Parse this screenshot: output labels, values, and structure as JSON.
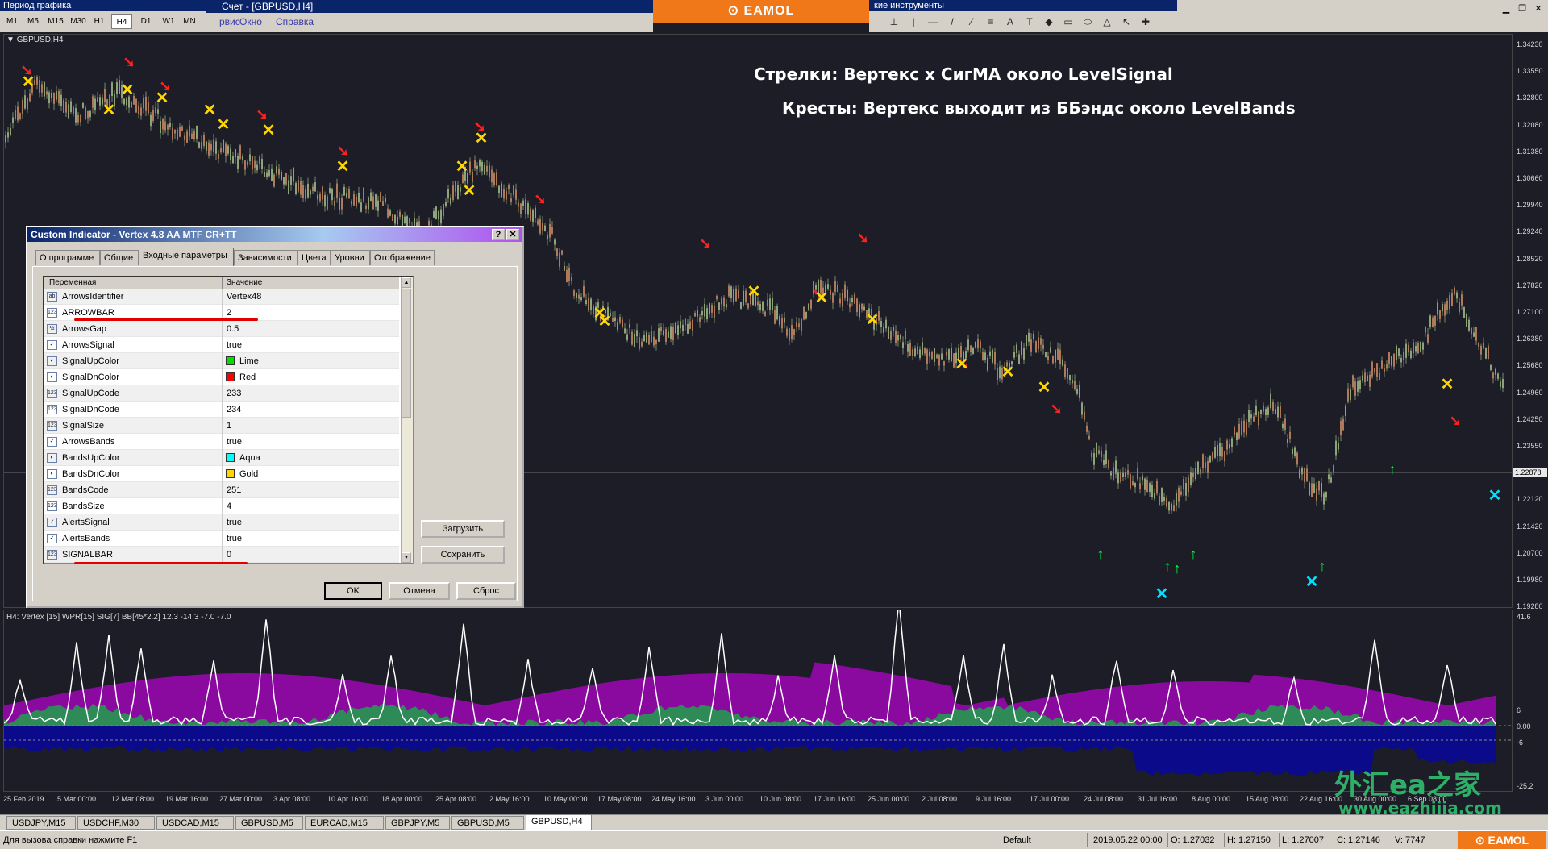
{
  "timeframe_panel": {
    "title": "Период графика",
    "buttons": [
      "M1",
      "M5",
      "M15",
      "M30",
      "H1",
      "H4",
      "D1",
      "W1",
      "MN"
    ],
    "selected": "H4"
  },
  "menu": {
    "window_title": "Счет - [GBPUSD,H4]",
    "items": [
      "рвис",
      "Окно",
      "Справка"
    ]
  },
  "banner": {
    "text": "EAMOL"
  },
  "drawing_toolbar": {
    "title": "кие инструменты",
    "tools": [
      "⊥",
      "|",
      "—",
      "/",
      "⁄",
      "≡",
      "A",
      "T",
      "◆",
      "▭",
      "⬭",
      "△",
      "↖",
      "✚"
    ]
  },
  "chart": {
    "symbol_label": "GBPUSD,H4",
    "annotation_arrows": "Стрелки: Вертекс х СигМА около LevelSignal",
    "annotation_crosses": "Кресты: Вертекс выходит из ББэндс около LevelBands",
    "current_price": "1.22878",
    "price_ticks": [
      "1.34230",
      "1.33550",
      "1.32800",
      "1.32080",
      "1.31380",
      "1.30660",
      "1.29940",
      "1.29240",
      "1.28520",
      "1.27820",
      "1.27100",
      "1.26380",
      "1.25680",
      "1.24960",
      "1.24250",
      "1.23550",
      "1.22840",
      "1.22120",
      "1.21420",
      "1.20700",
      "1.19980",
      "1.19280"
    ],
    "colors": {
      "bg": "#1c1d27",
      "candles": "#8a9a7a",
      "arrow_down": "#ff2020",
      "arrow_up": "#00ff40",
      "cross_gold": "#ffd700",
      "cross_aqua": "#00e0ff"
    }
  },
  "indicator": {
    "label": "H4: Vertex [15]  WPR[15]  SIG[7]  BB[45*2.2]  12.3  -14.3  -7.0  -7.0",
    "axis_ticks": [
      "41.6",
      "6",
      "0.00",
      "-6",
      "-25.2"
    ],
    "colors": {
      "upper_band": "#8a0aa0",
      "lower_band": "#0a0a8a",
      "histogram": "#2e8b57",
      "line": "#ffffff"
    }
  },
  "time_axis": [
    "25 Feb 2019",
    "5 Mar 00:00",
    "12 Mar 08:00",
    "19 Mar 16:00",
    "27 Mar 00:00",
    "3 Apr 08:00",
    "10 Apr 16:00",
    "18 Apr 00:00",
    "25 Apr 08:00",
    "2 May 16:00",
    "10 May 00:00",
    "17 May 08:00",
    "24 May 16:00",
    "3 Jun 00:00",
    "10 Jun 08:00",
    "17 Jun 16:00",
    "25 Jun 00:00",
    "2 Jul 08:00",
    "9 Jul 16:00",
    "17 Jul 00:00",
    "24 Jul 08:00",
    "31 Jul 16:00",
    "8 Aug 00:00",
    "15 Aug 08:00",
    "22 Aug 16:00",
    "30 Aug 00:00",
    "6 Sep 08:00"
  ],
  "watermark": {
    "top": "外汇ea之家",
    "bottom": "www.eazhijia.com"
  },
  "tabs": [
    "USDJPY,M15",
    "USDCHF,M30",
    "USDCAD,M15",
    "GBPUSD,M5",
    "EURCAD,M15",
    "GBPJPY,M5",
    "GBPUSD,M5",
    "GBPUSD,H4"
  ],
  "active_tab": "GBPUSD,H4",
  "status": {
    "help": "Для вызова справки нажмите F1",
    "profile": "Default",
    "datetime": "2019.05.22 00:00",
    "open": "O: 1.27032",
    "high": "H: 1.27150",
    "low": "L: 1.27007",
    "close": "C: 1.27146",
    "volume": "V: 7747",
    "badge": "EAMOL"
  },
  "dialog": {
    "title": "Custom Indicator - Vertex 4.8 AA MTF CR+TT",
    "help_btn": "?",
    "close_btn": "✕",
    "tabs": [
      "О программе",
      "Общие",
      "Входные параметры",
      "Зависимости",
      "Цвета",
      "Уровни",
      "Отображение"
    ],
    "active_tab": "Входные параметры",
    "col_variable": "Переменная",
    "col_value": "Значение",
    "rows": [
      {
        "icon": "ab",
        "name": "ArrowsIdentifier",
        "value": "Vertex48"
      },
      {
        "icon": "123",
        "name": "ARROWBAR",
        "value": "2"
      },
      {
        "icon": "½",
        "name": "ArrowsGap",
        "value": "0.5"
      },
      {
        "icon": "✓",
        "name": "ArrowsSignal",
        "value": "true"
      },
      {
        "icon": "◐",
        "name": "SignalUpColor",
        "value": "Lime",
        "color": "#00e000"
      },
      {
        "icon": "◐",
        "name": "SignalDnColor",
        "value": "Red",
        "color": "#ff0000"
      },
      {
        "icon": "123",
        "name": "SignalUpCode",
        "value": "233"
      },
      {
        "icon": "123",
        "name": "SignalDnCode",
        "value": "234"
      },
      {
        "icon": "123",
        "name": "SignalSize",
        "value": "1"
      },
      {
        "icon": "✓",
        "name": "ArrowsBands",
        "value": "true"
      },
      {
        "icon": "◐",
        "name": "BandsUpColor",
        "value": "Aqua",
        "color": "#00ffff"
      },
      {
        "icon": "◐",
        "name": "BandsDnColor",
        "value": "Gold",
        "color": "#ffd700"
      },
      {
        "icon": "123",
        "name": "BandsCode",
        "value": "251"
      },
      {
        "icon": "123",
        "name": "BandsSize",
        "value": "4"
      },
      {
        "icon": "✓",
        "name": "AlertsSignal",
        "value": "true"
      },
      {
        "icon": "✓",
        "name": "AlertsBands",
        "value": "true"
      },
      {
        "icon": "123",
        "name": "SIGNALBAR",
        "value": "0"
      }
    ],
    "load_btn": "Загрузить",
    "save_btn": "Сохранить",
    "ok_btn": "OK",
    "cancel_btn": "Отмена",
    "reset_btn": "Сброс"
  }
}
